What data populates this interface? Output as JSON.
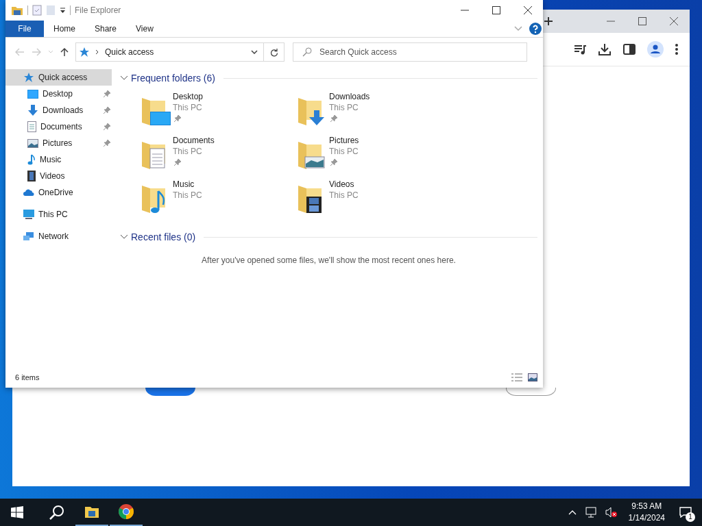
{
  "explorer": {
    "title": "File Explorer",
    "ribbon_tabs": [
      {
        "label": "File",
        "kind": "menu"
      },
      {
        "label": "Home",
        "kind": "tab"
      },
      {
        "label": "Share",
        "kind": "tab"
      },
      {
        "label": "View",
        "kind": "tab"
      }
    ],
    "address": {
      "path": "Quick access"
    },
    "search": {
      "placeholder": "Search Quick access"
    },
    "sidebar": [
      {
        "label": "Quick access",
        "kind": "star",
        "selected": true,
        "children": [
          {
            "label": "Desktop",
            "kind": "desktop",
            "pinned": true,
            "selected": false
          },
          {
            "label": "Downloads",
            "kind": "downloads",
            "pinned": true,
            "selected": false
          },
          {
            "label": "Documents",
            "kind": "documents",
            "pinned": true,
            "selected": false
          },
          {
            "label": "Pictures",
            "kind": "pictures",
            "pinned": true,
            "selected": false
          },
          {
            "label": "Music",
            "kind": "music",
            "pinned": false,
            "selected": false
          },
          {
            "label": "Videos",
            "kind": "videos",
            "pinned": false,
            "selected": false
          }
        ]
      },
      {
        "label": "OneDrive",
        "kind": "cloud",
        "selected": false
      },
      {
        "label": "This PC",
        "kind": "pc",
        "selected": false
      },
      {
        "label": "Network",
        "kind": "network",
        "selected": false
      }
    ],
    "frequent_folders": {
      "title": "Frequent folders (6)",
      "expanded": true,
      "folders": [
        {
          "name": "Desktop",
          "location": "This PC",
          "kind": "desktop",
          "pinned": true
        },
        {
          "name": "Downloads",
          "location": "This PC",
          "kind": "downloads",
          "pinned": true
        },
        {
          "name": "Documents",
          "location": "This PC",
          "kind": "documents",
          "pinned": true
        },
        {
          "name": "Pictures",
          "location": "This PC",
          "kind": "pictures",
          "pinned": true
        },
        {
          "name": "Music",
          "location": "This PC",
          "kind": "music",
          "pinned": false
        },
        {
          "name": "Videos",
          "location": "This PC",
          "kind": "videos",
          "pinned": false
        }
      ]
    },
    "recent_files": {
      "title": "Recent files (0)",
      "expanded": true,
      "message": "After you've opened some files, we'll show the most recent ones here."
    },
    "status_bar": {
      "item_count": "6 items"
    }
  },
  "taskbar": {
    "time": "9:53 AM",
    "date": "1/14/2024",
    "notification_count": "1"
  }
}
